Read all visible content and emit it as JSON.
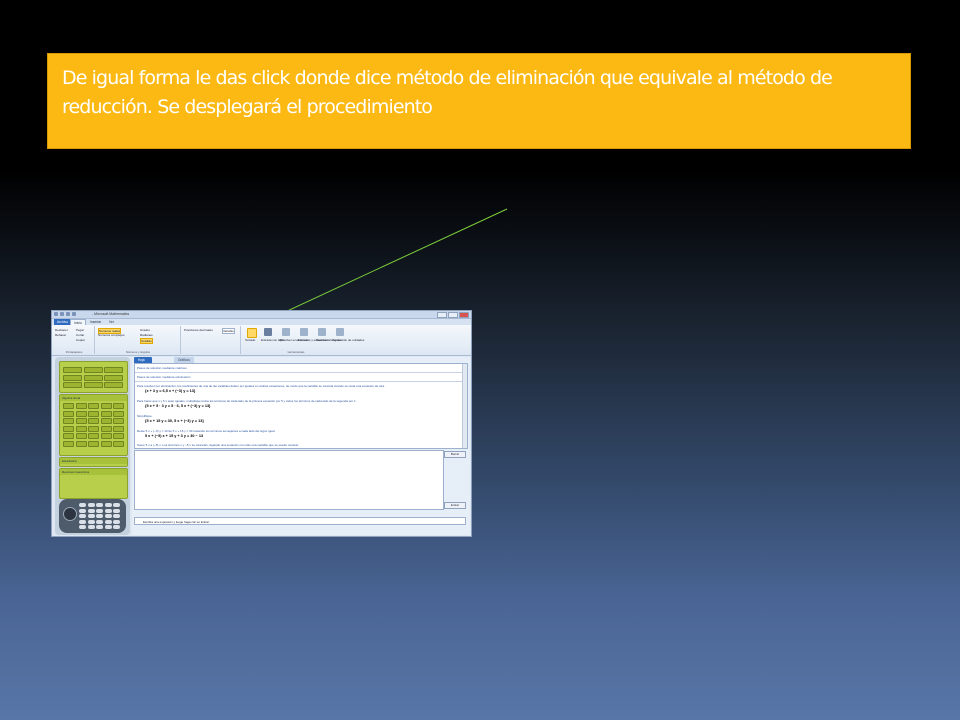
{
  "callout": {
    "text": "De igual forma le das click donde dice método de eliminación que equivale al método de reducción. Se desplegará el procedimiento"
  },
  "app": {
    "window_title": "- Microsoft Mathematics",
    "tabs": [
      "Archivo",
      "Inicio",
      "Insertar",
      "Ver"
    ],
    "ribbon": {
      "clipboard": {
        "items": [
          "Deshacer",
          "Pegar",
          "Rehacer",
          "Cortar",
          "Copiar"
        ],
        "label": "Portapapeles"
      },
      "numbers": {
        "items": [
          "Números reales",
          "Números complejos",
          "Grados",
          "Radianes",
          "Gradián"
        ],
        "label": "Números y ángulos"
      },
      "decimals_label": "Posiciones decimales",
      "decimals_value": "Variable",
      "tools": {
        "items": [
          "Teclado",
          "Entrada con lápiz",
          "Resolver ecuaciones",
          "Fórmulas y ecuaciones",
          "Resolver triángulos",
          "Conversión de unidades"
        ],
        "label": "Herramientas"
      }
    },
    "worksheet_tabs": [
      "Hoja de cálculo",
      "Gráficos"
    ],
    "steps": [
      "Pasos de solución mediante matrices",
      "Pasos de solución mediante eliminación",
      "Para resolver por eliminación, los coeficientes de una de las variables deben ser iguales en ambas ecuaciones, de modo que la variable se cancela cuando se resta una ecuación de otra.",
      "{x + 3 y = 6,5 x + (−3) y = 13}",
      "Para hacer que x y 5 x sean iguales, multiplique todos los términos de cada lado de la primera ecuación por 5 y todos los términos de cada lado de la segunda por 1.",
      "{5 x + 5 · 3 y = 5 · 6, 5 x + (−3) y = 13}",
      "Simplifique.",
      "{5 x + 15 y = 30, 5 x + (−3) y = 13}",
      "Reste 5 x + (−3) y = 13 de 5 x + 15 y = 30 restando los términos semejantes a cada lado del signo igual.",
      "5 x + (−5) x + 15 y + 3 y = 30 − 13",
      "Sume 5 x a (−5) x. Los términos x y −5 x se cancelan, dejando una ecuación con sólo una variable que se puede resolver."
    ],
    "buttons": {
      "clear": "Borrar",
      "enter": "Entrar"
    },
    "status_text": "Escriba una expresión y luego haga clic en Entrar.",
    "calculator": {
      "panel1": "Álgebra lineal",
      "panel2": "Estadística",
      "panel3": "Recursos Genéricos"
    }
  },
  "colors": {
    "callout_bg": "#fdb913",
    "arrow": "#7dcf3a"
  }
}
